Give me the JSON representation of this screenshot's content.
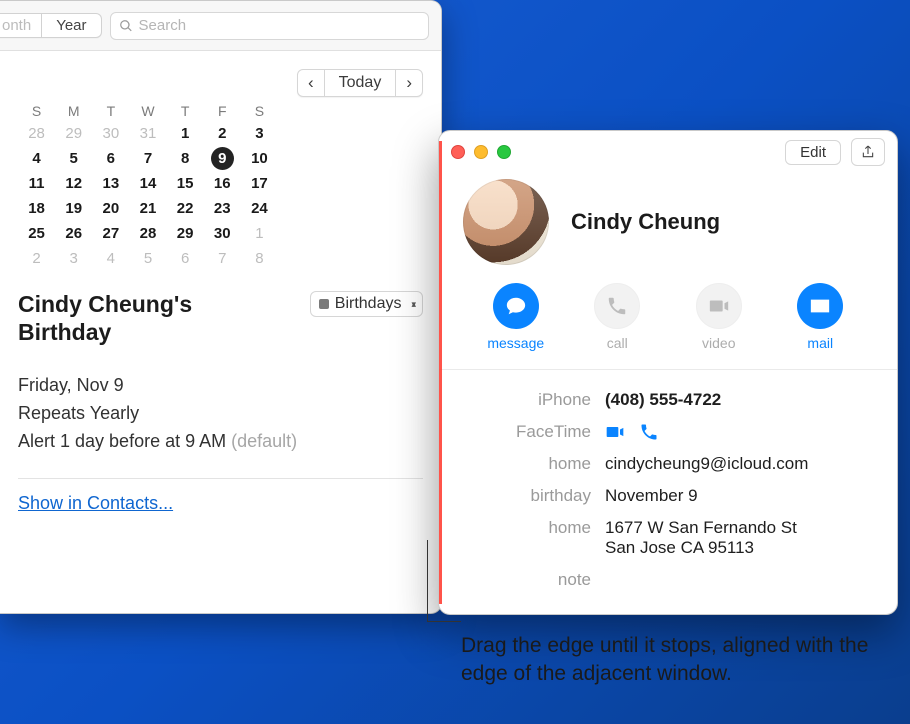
{
  "calendar": {
    "view_tabs": {
      "month": "onth",
      "year": "Year"
    },
    "search_placeholder": "Search",
    "nav": {
      "prev": "‹",
      "today": "Today",
      "next": "›"
    },
    "dow": [
      "S",
      "M",
      "T",
      "W",
      "T",
      "F",
      "S"
    ],
    "weeks": [
      [
        "28",
        "29",
        "30",
        "31",
        "1",
        "2",
        "3"
      ],
      [
        "4",
        "5",
        "6",
        "7",
        "8",
        "9",
        "10"
      ],
      [
        "11",
        "12",
        "13",
        "14",
        "15",
        "16",
        "17"
      ],
      [
        "18",
        "19",
        "20",
        "21",
        "22",
        "23",
        "24"
      ],
      [
        "25",
        "26",
        "27",
        "28",
        "29",
        "30",
        "1"
      ],
      [
        "2",
        "3",
        "4",
        "5",
        "6",
        "7",
        "8"
      ]
    ],
    "today_cell": "9",
    "event": {
      "title": "Cindy Cheung's Birthday",
      "category": "Birthdays",
      "date": "Friday, Nov 9",
      "repeat": "Repeats Yearly",
      "alert": "Alert 1 day before at 9 AM",
      "alert_suffix": "(default)",
      "link": "Show in Contacts..."
    }
  },
  "contact": {
    "edit": "Edit",
    "name": "Cindy Cheung",
    "actions": {
      "message": "message",
      "call": "call",
      "video": "video",
      "mail": "mail"
    },
    "fields": {
      "iphone_label": "iPhone",
      "iphone_value": "(408) 555-4722",
      "facetime_label": "FaceTime",
      "home_email_label": "home",
      "home_email_value": "cindycheung9@icloud.com",
      "birthday_label": "birthday",
      "birthday_value": "November 9",
      "home_addr_label": "home",
      "home_addr_line1": "1677 W San Fernando St",
      "home_addr_line2": "San Jose CA 95113",
      "note_label": "note"
    }
  },
  "callout": "Drag the edge until it stops, aligned with the edge of the adjacent window."
}
